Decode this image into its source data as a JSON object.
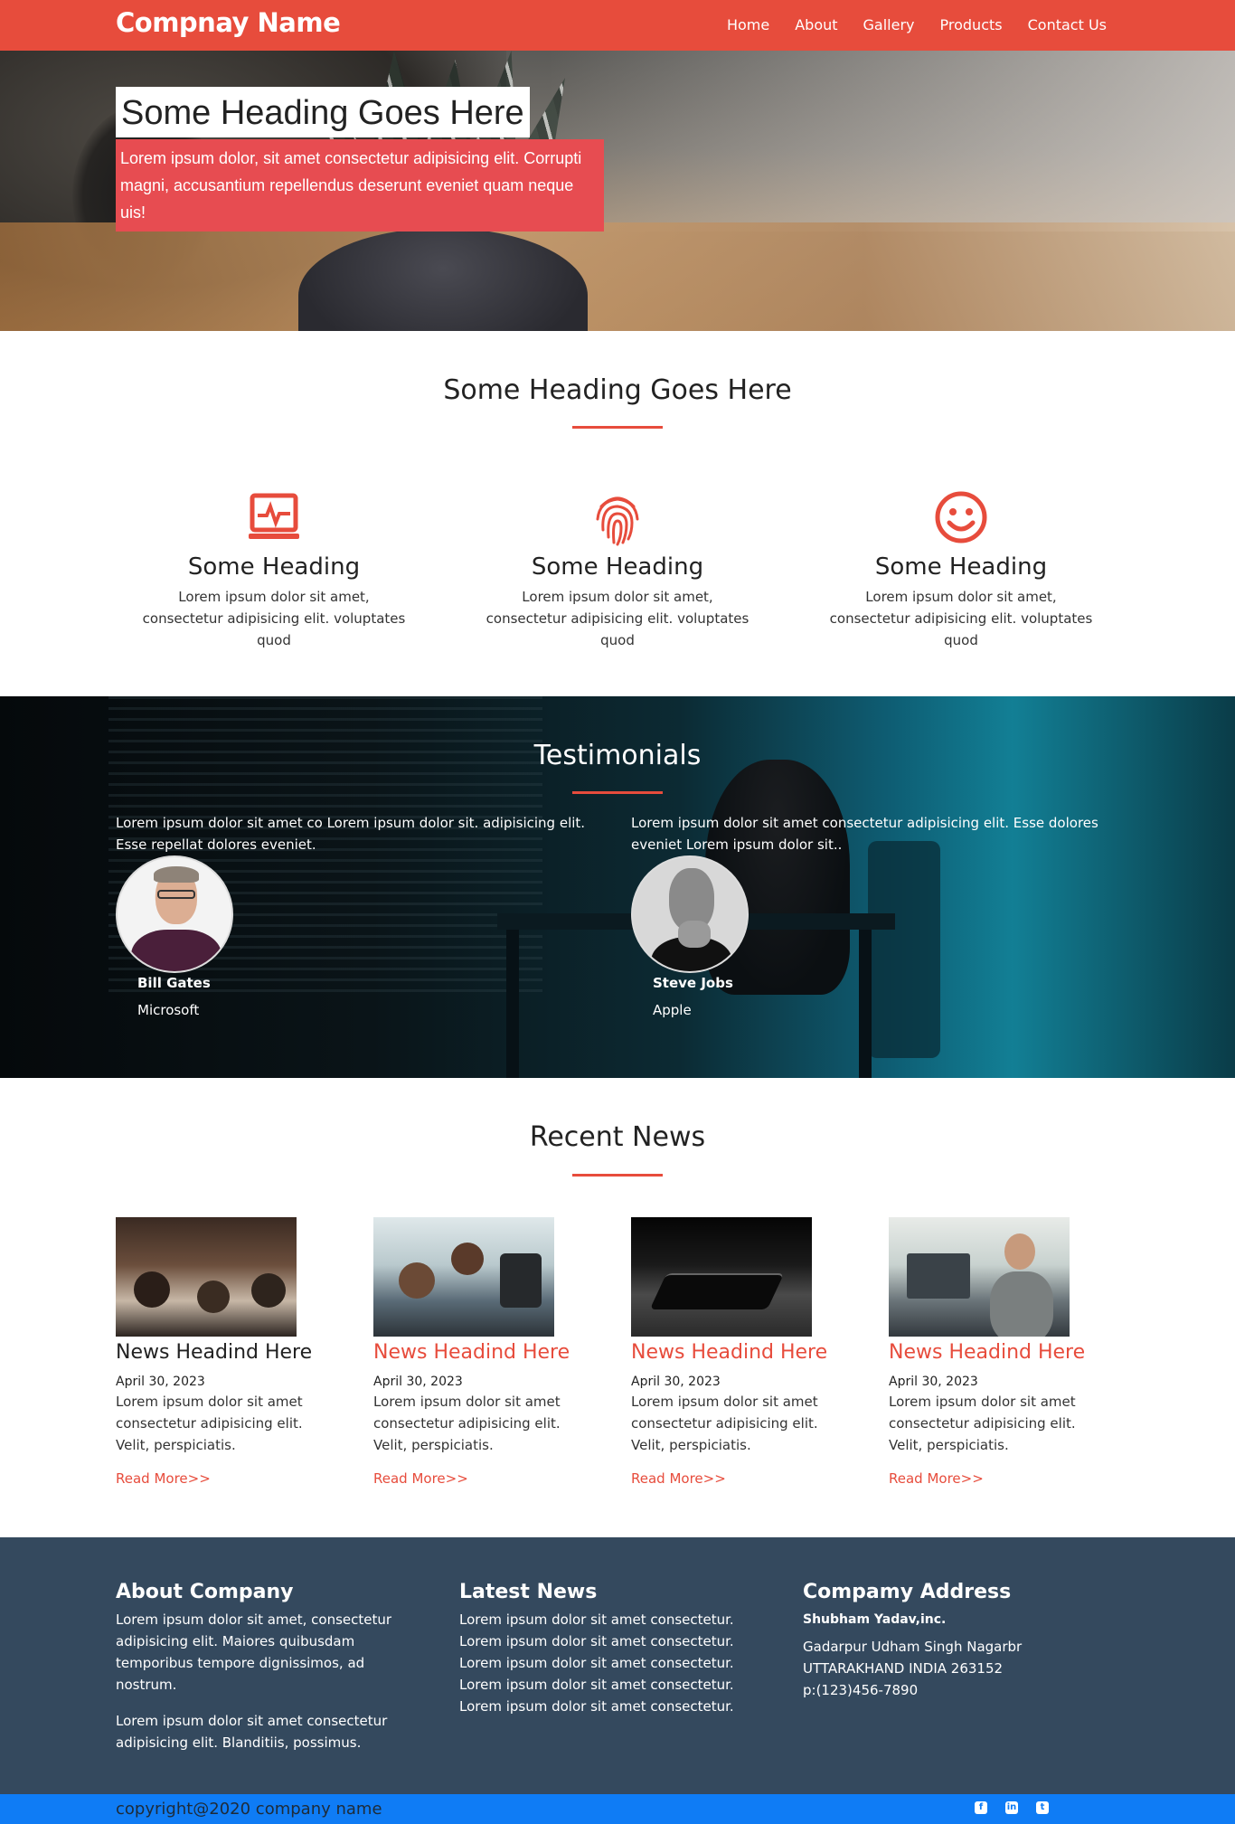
{
  "nav": {
    "brand": "Compnay Name",
    "items": [
      "Home",
      "About",
      "Gallery",
      "Products",
      "Contact Us"
    ]
  },
  "hero": {
    "title": "Some Heading Goes Here",
    "text": "Lorem ipsum dolor, sit amet consectetur adipisicing elit. Corrupti magni, accusantium repellendus deserunt eveniet quam neque uis!"
  },
  "features": {
    "title": "Some Heading Goes Here",
    "items": [
      {
        "icon": "monitor-pulse-icon",
        "heading": "Some Heading",
        "text": "Lorem ipsum dolor sit amet, consectetur adipisicing elit. voluptates quod"
      },
      {
        "icon": "fingerprint-icon",
        "heading": "Some Heading",
        "text": "Lorem ipsum dolor sit amet, consectetur adipisicing elit. voluptates quod"
      },
      {
        "icon": "smile-icon",
        "heading": "Some Heading",
        "text": "Lorem ipsum dolor sit amet, consectetur adipisicing elit. voluptates quod"
      }
    ]
  },
  "testimonials": {
    "title": "Testimonials",
    "items": [
      {
        "text": "Lorem ipsum dolor sit amet co Lorem ipsum dolor sit. adipisicing elit. Esse repellat dolores eveniet.",
        "name": "Bill Gates",
        "company": "Microsoft"
      },
      {
        "text": "Lorem ipsum dolor sit amet consectetur adipisicing elit. Esse dolores eveniet Lorem ipsum dolor sit..",
        "name": "Steve Jobs",
        "company": "Apple"
      }
    ]
  },
  "news": {
    "title": "Recent News",
    "items": [
      {
        "heading": "News Headind Here",
        "date": "April 30, 2023",
        "text": "Lorem ipsum dolor sit amet consectetur adipisicing elit. Velit, perspiciatis.",
        "link": "Read More>>"
      },
      {
        "heading": "News Headind Here",
        "date": "April 30, 2023",
        "text": "Lorem ipsum dolor sit amet consectetur adipisicing elit. Velit, perspiciatis.",
        "link": "Read More>>"
      },
      {
        "heading": "News Headind Here",
        "date": "April 30, 2023",
        "text": "Lorem ipsum dolor sit amet consectetur adipisicing elit. Velit, perspiciatis.",
        "link": "Read More>>"
      },
      {
        "heading": "News Headind Here",
        "date": "April 30, 2023",
        "text": "Lorem ipsum dolor sit amet consectetur adipisicing elit. Velit, perspiciatis.",
        "link": "Read More>>"
      }
    ]
  },
  "footer": {
    "about": {
      "title": "About Company",
      "p1": "Lorem ipsum dolor sit amet, consectetur adipisicing elit. Maiores quibusdam temporibus tempore dignissimos, ad nostrum.",
      "p2": "Lorem ipsum dolor sit amet consectetur adipisicing elit. Blanditiis, possimus."
    },
    "latest": {
      "title": "Latest News",
      "items": [
        "Lorem ipsum dolor sit amet consectetur.",
        "Lorem ipsum dolor sit amet consectetur.",
        "Lorem ipsum dolor sit amet consectetur.",
        "Lorem ipsum dolor sit amet consectetur.",
        "Lorem ipsum dolor sit amet consectetur."
      ]
    },
    "address": {
      "title": "Compamy Address",
      "company": "Shubham Yadav,inc.",
      "line1": "Gadarpur Udham Singh Nagarbr",
      "line2": "UTTARAKHAND INDIA 263152",
      "phone": "p:(123)456-7890"
    },
    "copyright": "copyright@2020 company name",
    "social": [
      "facebook-icon",
      "linkedin-icon",
      "twitter-icon"
    ]
  },
  "colors": {
    "accent": "#e74c3c",
    "footer_bg": "#34495e",
    "bottom_bar": "#0f7cf5"
  }
}
